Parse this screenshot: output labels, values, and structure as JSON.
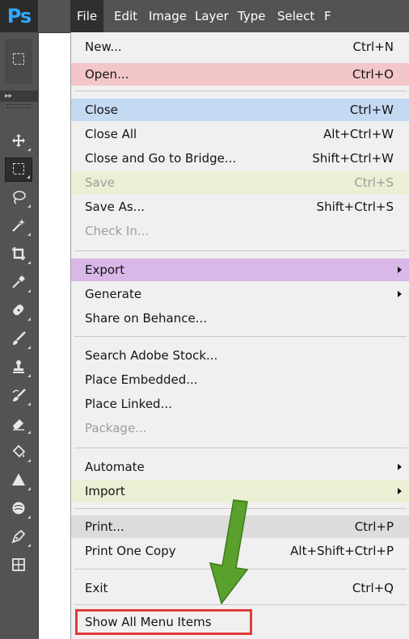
{
  "toolbar": {
    "logo": "Ps",
    "tools": [
      {
        "name": "marquee-top-icon"
      },
      {
        "name": "move-icon"
      },
      {
        "name": "rectangular-marquee-icon"
      },
      {
        "name": "lasso-icon"
      },
      {
        "name": "magic-wand-icon"
      },
      {
        "name": "crop-icon"
      },
      {
        "name": "eyedropper-icon"
      },
      {
        "name": "healing-brush-icon"
      },
      {
        "name": "brush-icon"
      },
      {
        "name": "clone-stamp-icon"
      },
      {
        "name": "history-brush-icon"
      },
      {
        "name": "eraser-icon"
      },
      {
        "name": "paint-bucket-icon"
      },
      {
        "name": "sharpen-icon"
      },
      {
        "name": "dodge-icon"
      },
      {
        "name": "pen-icon"
      }
    ]
  },
  "menubar": {
    "items": [
      "File",
      "Edit",
      "Image",
      "Layer",
      "Type",
      "Select",
      "F"
    ],
    "open": "File"
  },
  "file_menu": {
    "new": {
      "label": "New...",
      "shortcut": "Ctrl+N"
    },
    "open": {
      "label": "Open...",
      "shortcut": "Ctrl+O"
    },
    "close": {
      "label": "Close",
      "shortcut": "Ctrl+W"
    },
    "close_all": {
      "label": "Close All",
      "shortcut": "Alt+Ctrl+W"
    },
    "close_bridge": {
      "label": "Close and Go to Bridge...",
      "shortcut": "Shift+Ctrl+W"
    },
    "save": {
      "label": "Save",
      "shortcut": "Ctrl+S"
    },
    "save_as": {
      "label": "Save As...",
      "shortcut": "Shift+Ctrl+S"
    },
    "check_in": {
      "label": "Check In..."
    },
    "export": {
      "label": "Export"
    },
    "generate": {
      "label": "Generate"
    },
    "share_behance": {
      "label": "Share on Behance..."
    },
    "search_stock": {
      "label": "Search Adobe Stock..."
    },
    "place_embedded": {
      "label": "Place Embedded..."
    },
    "place_linked": {
      "label": "Place Linked..."
    },
    "package": {
      "label": "Package..."
    },
    "automate": {
      "label": "Automate"
    },
    "import": {
      "label": "Import"
    },
    "print": {
      "label": "Print...",
      "shortcut": "Ctrl+P"
    },
    "print_one": {
      "label": "Print One Copy",
      "shortcut": "Alt+Shift+Ctrl+P"
    },
    "exit": {
      "label": "Exit",
      "shortcut": "Ctrl+Q"
    },
    "show_all": {
      "label": "Show All Menu Items"
    }
  },
  "colors": {
    "highlight_red": "#f3c7c9",
    "highlight_blue": "#c4d9f2",
    "highlight_yellow": "#eaf0d3",
    "highlight_purple": "#d9b7e8",
    "annotation_box": "#e23b3b",
    "annotation_arrow": "#5aa02c"
  }
}
